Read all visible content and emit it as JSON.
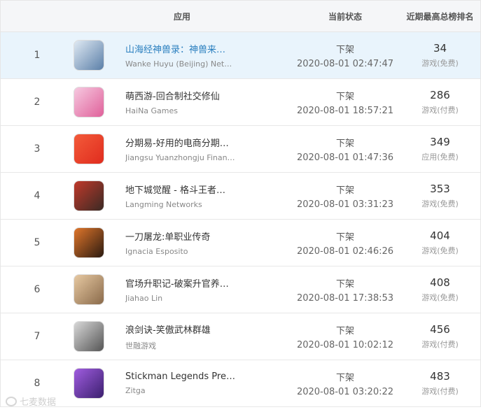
{
  "header": {
    "app": "应用",
    "status": "当前状态",
    "top": "近期最高总榜排名"
  },
  "rows": [
    {
      "rank": "1",
      "icon": "shanhaijing-app-icon",
      "name": "山海经神兽录：神兽来…",
      "dev": "Wanke Huyu (Beijing) Netw…",
      "status": "下架",
      "time": "2020-08-01 02:47:47",
      "top": "34",
      "cat": "游戏(免费)",
      "c1": "#5b7fa8",
      "c2": "#dfe9f3"
    },
    {
      "rank": "2",
      "icon": "mengxiyou-app-icon",
      "name": "萌西游-回合制社交修仙",
      "dev": "HaiNa Games",
      "status": "下架",
      "time": "2020-08-01 18:57:21",
      "top": "286",
      "cat": "游戏(付费)",
      "c1": "#e0609a",
      "c2": "#f6c9e0"
    },
    {
      "rank": "3",
      "icon": "fenqiyi-app-icon",
      "name": "分期易-好用的电商分期…",
      "dev": "Jiangsu Yuanzhongju Finan…",
      "status": "下架",
      "time": "2020-08-01 01:47:36",
      "top": "349",
      "cat": "应用(免费)",
      "c1": "#e02c1e",
      "c2": "#f35b3a"
    },
    {
      "rank": "4",
      "icon": "dixiacheng-app-icon",
      "name": "地下城觉醒 - 格斗王者…",
      "dev": "Langming Networks",
      "status": "下架",
      "time": "2020-08-01 03:31:23",
      "top": "353",
      "cat": "游戏(免费)",
      "c1": "#3a2a24",
      "c2": "#c0392b"
    },
    {
      "rank": "5",
      "icon": "yidaotulong-app-icon",
      "name": "一刀屠龙:单职业传奇",
      "dev": "Ignacia Esposito",
      "status": "下架",
      "time": "2020-08-01 02:46:26",
      "top": "404",
      "cat": "游戏(免费)",
      "c1": "#2b1a10",
      "c2": "#e0762b"
    },
    {
      "rank": "6",
      "icon": "guanchang-app-icon",
      "name": "官场升职记-破案升官养…",
      "dev": "Jiahao Lin",
      "status": "下架",
      "time": "2020-08-01 17:38:53",
      "top": "408",
      "cat": "游戏(免费)",
      "c1": "#8a6a4a",
      "c2": "#e7c9a2"
    },
    {
      "rank": "7",
      "icon": "langjianjue-app-icon",
      "name": "浪剑诀-笑傲武林群雄",
      "dev": "世融游戏",
      "status": "下架",
      "time": "2020-08-01 10:02:12",
      "top": "456",
      "cat": "游戏(付费)",
      "c1": "#555555",
      "c2": "#d8d8d8"
    },
    {
      "rank": "8",
      "icon": "stickman-app-icon",
      "name": "Stickman Legends Pre…",
      "dev": "Zitga",
      "status": "下架",
      "time": "2020-08-01 03:20:22",
      "top": "483",
      "cat": "游戏(付费)",
      "c1": "#3b1f6e",
      "c2": "#a05de0"
    }
  ],
  "watermark": "七麦数据"
}
